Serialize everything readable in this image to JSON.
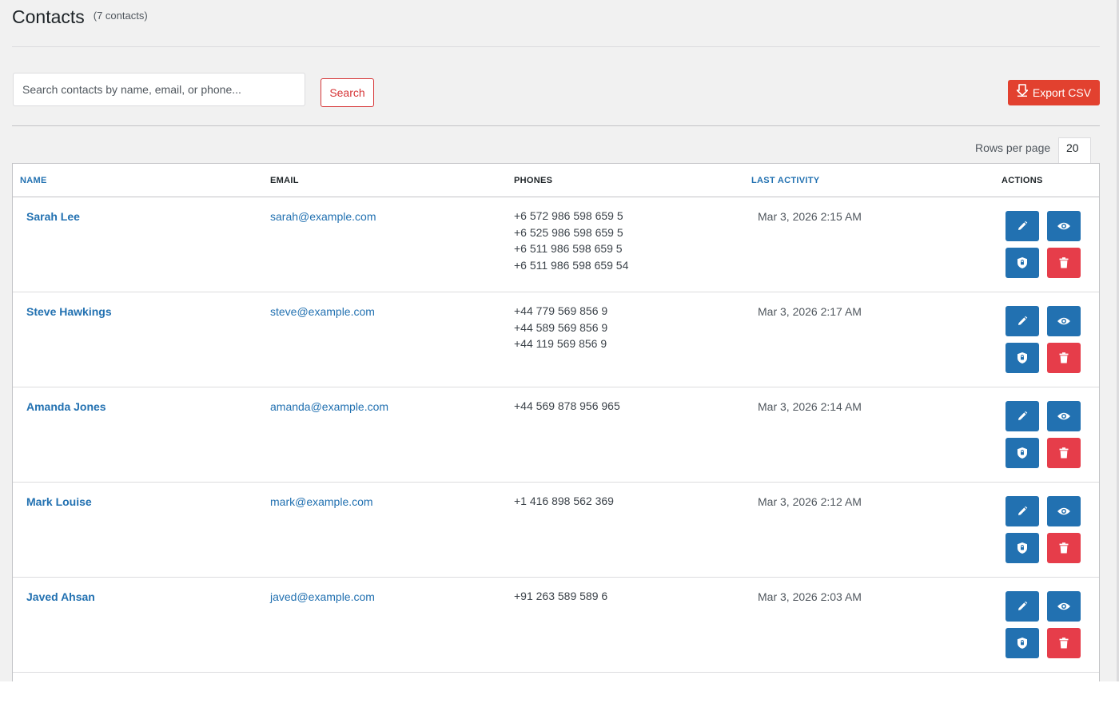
{
  "header": {
    "title": "Contacts",
    "count": "(7 contacts)"
  },
  "toolbar": {
    "search_placeholder": "Search contacts by name, email, or phone...",
    "search_label": "Search",
    "export_label": "Export CSV"
  },
  "pagination": {
    "rows_label": "Rows per page",
    "rows_value": "20"
  },
  "table": {
    "columns": [
      "NAME",
      "EMAIL",
      "PHONES",
      "LAST ACTIVITY",
      "ACTIONS"
    ],
    "rows": [
      {
        "name": "Sarah Lee",
        "email": "sarah@example.com",
        "phones": [
          "+6 572 986 598 659 5",
          "+6 525 986 598 659 5",
          "+6 511 986 598 659 5",
          "+6 511 986 598 659 54"
        ],
        "last_activity": "Mar 3, 2026 2:15 AM"
      },
      {
        "name": "Steve Hawkings",
        "email": "steve@example.com",
        "phones": [
          "+44 779 569 856 9",
          "+44 589 569 856 9",
          "+44 119 569 856 9"
        ],
        "last_activity": "Mar 3, 2026 2:17 AM"
      },
      {
        "name": "Amanda Jones",
        "email": "amanda@example.com",
        "phones": [
          "+44 569 878 956 965"
        ],
        "last_activity": "Mar 3, 2026 2:14 AM"
      },
      {
        "name": "Mark Louise",
        "email": "mark@example.com",
        "phones": [
          "+1 416 898 562 369"
        ],
        "last_activity": "Mar 3, 2026 2:12 AM"
      },
      {
        "name": "Javed Ahsan",
        "email": "javed@example.com",
        "phones": [
          "+91 263 589 589 6"
        ],
        "last_activity": "Mar 3, 2026 2:03 AM"
      }
    ]
  },
  "actions": [
    {
      "icon": "pencil-icon",
      "color": "#2271b1"
    },
    {
      "icon": "eye-icon",
      "color": "#2271b1"
    },
    {
      "icon": "shield-icon",
      "color": "#2271b1"
    },
    {
      "icon": "trash-icon",
      "color": "#e63d4a"
    }
  ],
  "colors": {
    "accent": "#2271b1",
    "danger": "#d63638",
    "export": "#e2412f"
  }
}
